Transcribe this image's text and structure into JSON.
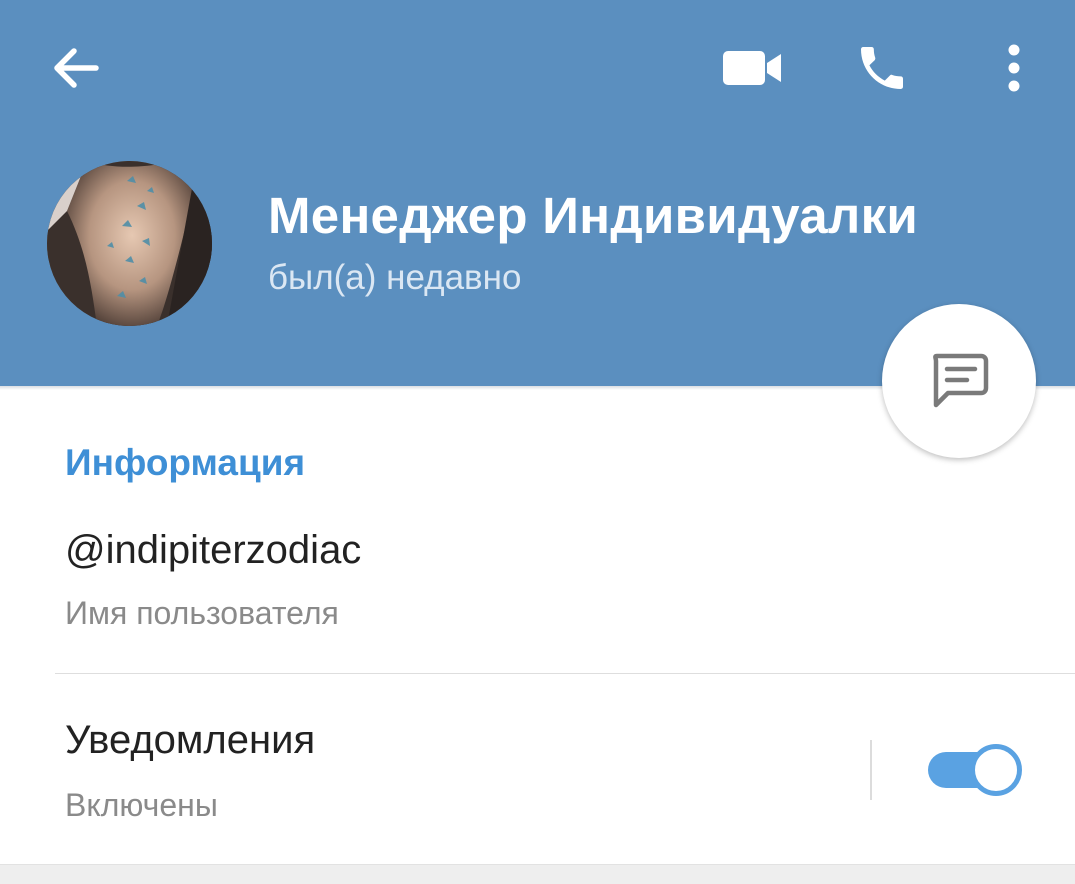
{
  "header": {
    "background_color": "#5b8fbf",
    "back_icon": "arrow-left-icon",
    "video_icon": "video-camera-icon",
    "call_icon": "phone-icon",
    "more_icon": "more-vertical-icon"
  },
  "profile": {
    "name": "Менеджер Индивидуалки",
    "status": "был(а) недавно"
  },
  "fab": {
    "icon": "message-icon"
  },
  "info": {
    "section_title": "Информация",
    "accent_color": "#3e8fd6",
    "username": "@indipiterzodiac",
    "username_label": "Имя пользователя"
  },
  "notifications": {
    "title": "Уведомления",
    "state": "Включены",
    "enabled": true
  }
}
